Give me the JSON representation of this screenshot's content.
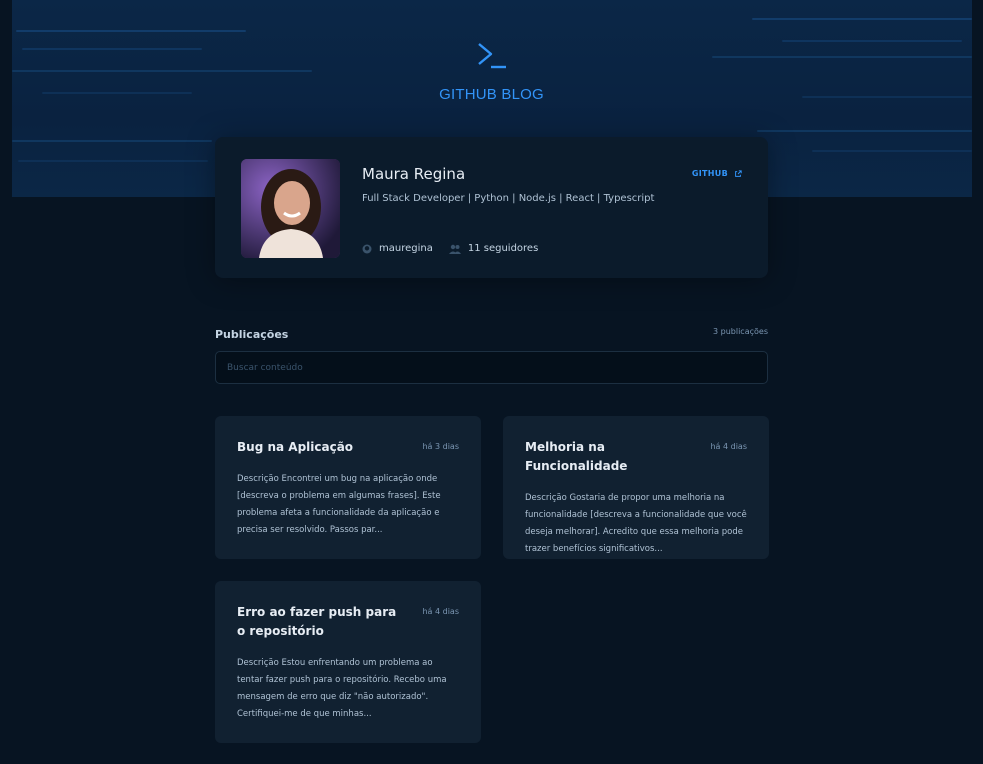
{
  "header": {
    "logo_icon": "terminal-icon",
    "title": "GITHUB BLOG"
  },
  "profile": {
    "name": "Maura Regina",
    "bio": "Full Stack Developer | Python | Node.js | React | Typescript",
    "github_label": "GITHUB",
    "github_icon": "external-link-icon",
    "username": "mauregina",
    "username_icon": "github-icon",
    "followers": "11 seguidores",
    "followers_icon": "users-icon"
  },
  "publications": {
    "title": "Publicações",
    "count": "3 publicações",
    "search_placeholder": "Buscar conteúdo"
  },
  "posts": [
    {
      "title": "Bug na Aplicação",
      "date": "há 3 dias",
      "excerpt": "Descrição Encontrei um bug na aplicação onde [descreva o problema em algumas frases]. Este problema afeta a funcionalidade da aplicação e precisa ser resolvido. Passos par..."
    },
    {
      "title": "Melhoria na Funcionalidade",
      "date": "há 4 dias",
      "excerpt": "Descrição Gostaria de propor uma melhoria na funcionalidade [descreva a funcionalidade que você deseja melhorar]. Acredito que essa melhoria pode trazer benefícios significativos..."
    },
    {
      "title": "Erro ao fazer push para o repositório",
      "date": "há 4 dias",
      "excerpt": "Descrição Estou enfrentando um problema ao tentar fazer push para o repositório. Recebo uma mensagem de erro que diz \"não autorizado\". Certifiquei-me de que minhas..."
    }
  ],
  "colors": {
    "accent": "#3294f8",
    "background": "#071422",
    "card": "#112131",
    "profile_card": "#0b1b2b"
  }
}
